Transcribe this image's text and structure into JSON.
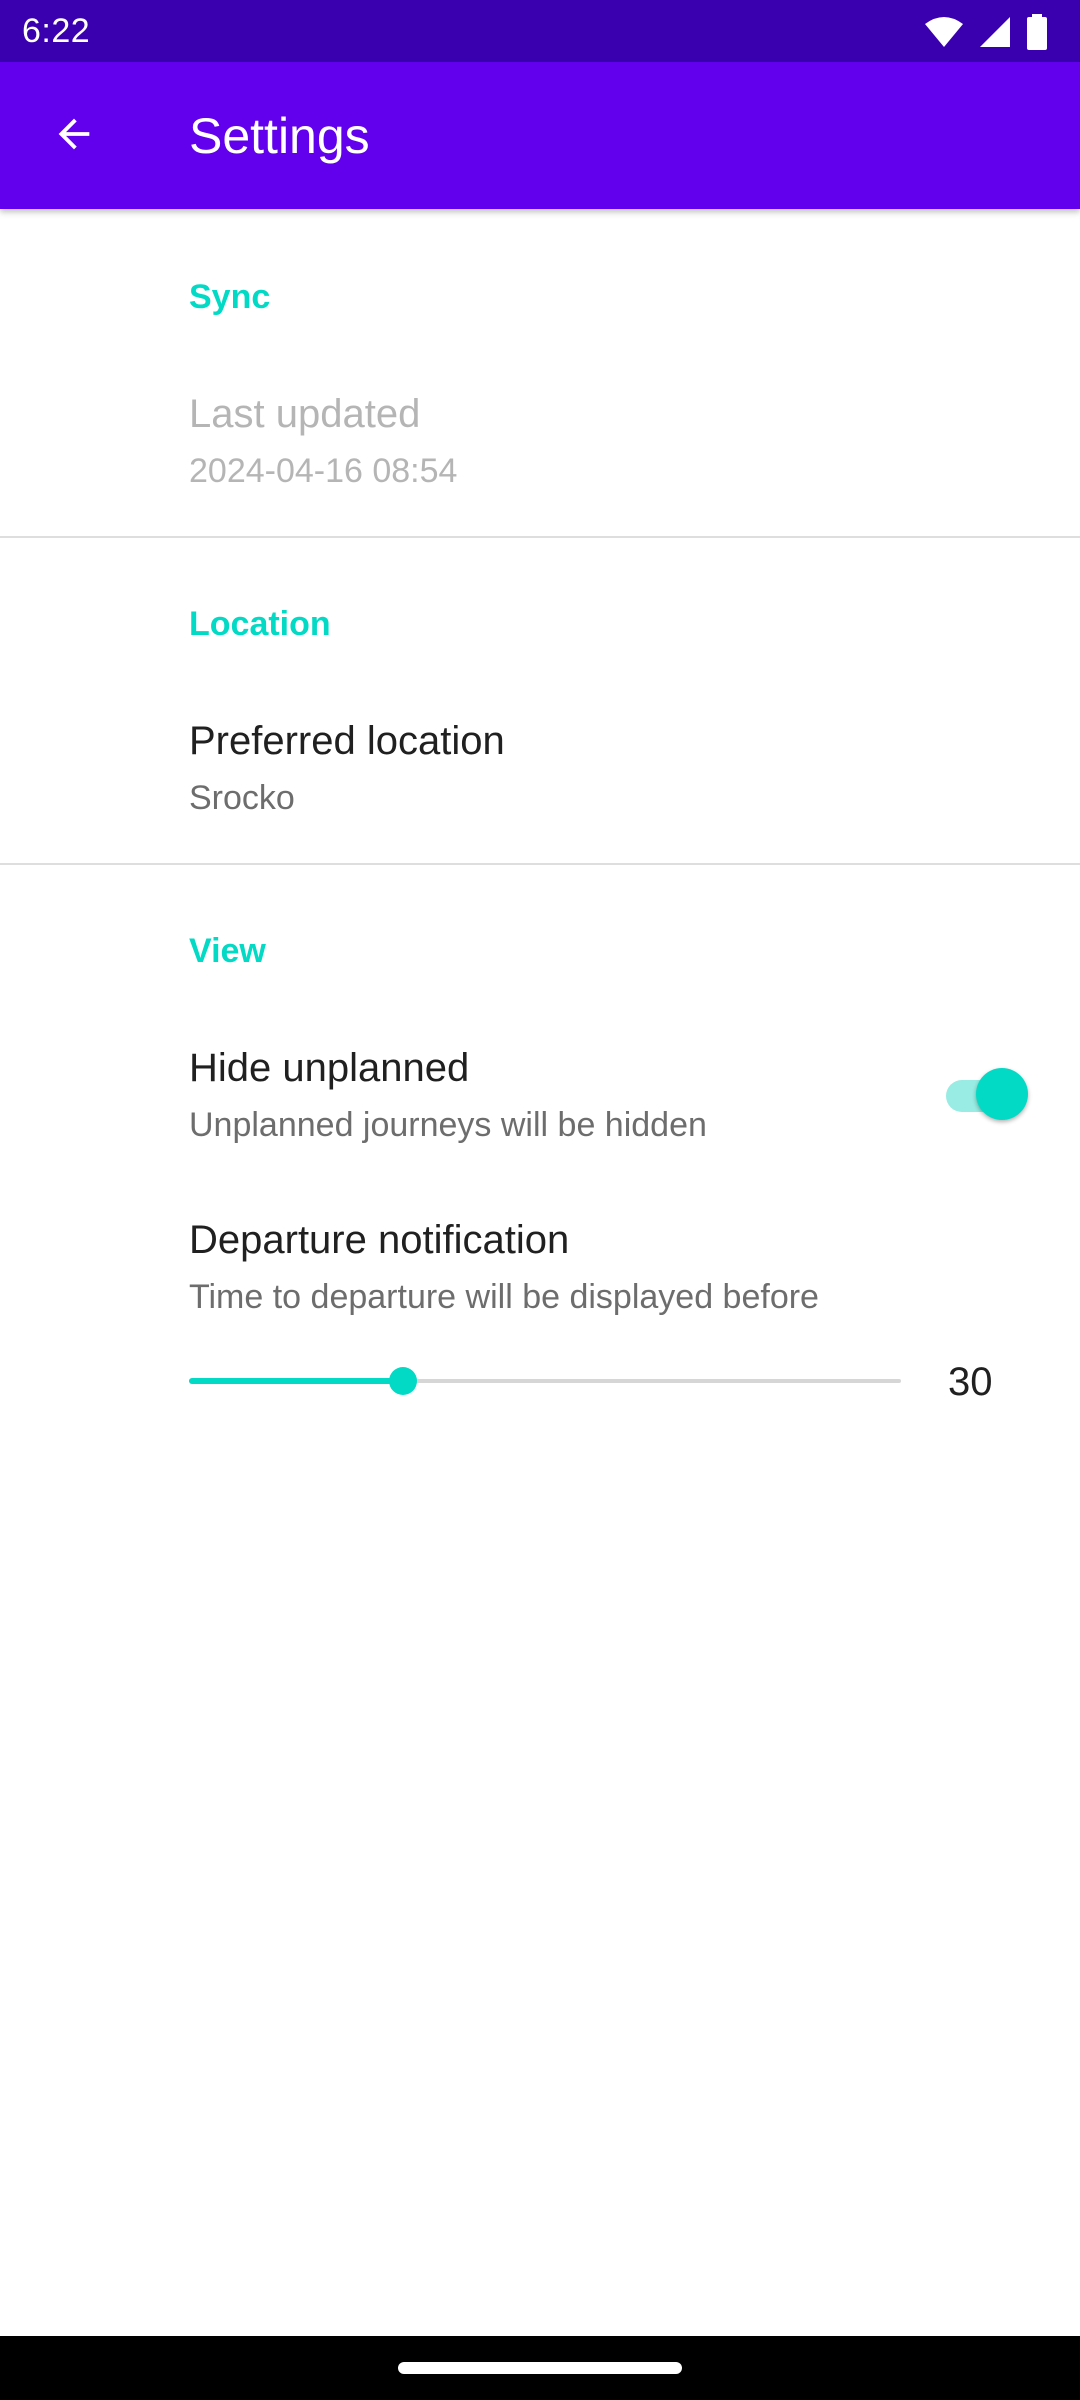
{
  "status_bar": {
    "time": "6:22",
    "icons": [
      "wifi-icon",
      "cellular-signal-icon",
      "battery-icon"
    ]
  },
  "app_bar": {
    "title": "Settings",
    "back_icon": "arrow-back-icon"
  },
  "sections": {
    "sync": {
      "header": "Sync",
      "last_updated": {
        "title": "Last updated",
        "summary": "2024-04-16 08:54",
        "enabled": false
      }
    },
    "location": {
      "header": "Location",
      "preferred_location": {
        "title": "Preferred location",
        "summary": "Srocko"
      }
    },
    "view": {
      "header": "View",
      "hide_unplanned": {
        "title": "Hide unplanned",
        "summary": "Unplanned journeys will be hidden",
        "checked": true
      },
      "departure_notification": {
        "title": "Departure notification",
        "summary": "Time to departure will be displayed before",
        "value": "30",
        "fill_fraction": 0.3
      }
    }
  },
  "colors": {
    "status_bar": "#3A00B0",
    "app_bar": "#6200EE",
    "accent": "#03DAC5"
  }
}
